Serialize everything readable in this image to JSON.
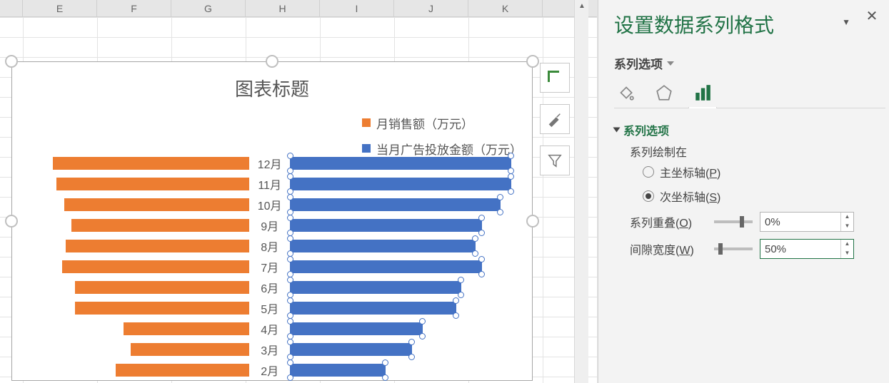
{
  "columns": [
    "E",
    "F",
    "G",
    "H",
    "I",
    "J",
    "K"
  ],
  "chart": {
    "title": "图表标题",
    "legend": {
      "series1": "月销售额（万元）",
      "series2": "当月广告投放金额（万元）"
    }
  },
  "chart_data": {
    "type": "bar",
    "orientation": "horizontal",
    "categories": [
      "12月",
      "11月",
      "10月",
      "9月",
      "8月",
      "7月",
      "6月",
      "5月",
      "4月",
      "3月",
      "2月"
    ],
    "series": [
      {
        "name": "月销售额（万元）",
        "color": "#ED7D31",
        "values": [
          265,
          260,
          250,
          240,
          248,
          252,
          235,
          235,
          170,
          160,
          180
        ]
      },
      {
        "name": "当月广告投放金额（万元）",
        "color": "#4472C4",
        "values": [
          300,
          300,
          285,
          260,
          252,
          260,
          232,
          225,
          180,
          165,
          130
        ]
      }
    ],
    "note": "Left orange bars plotted on reversed primary axis (grow leftward); right blue bars on secondary axis (selected). Values estimated from relative bar lengths; axes not shown.",
    "layout": {
      "legend_position": "top-right",
      "grid": false
    }
  },
  "tools": {
    "add": "plus-icon",
    "style": "brush-icon",
    "filter": "funnel-icon"
  },
  "pane": {
    "title": "设置数据系列格式",
    "subtitle": "系列选项",
    "section_header": "系列选项",
    "plot_on_label": "系列绘制在",
    "primary_axis": "主坐标轴",
    "primary_accel": "P",
    "secondary_axis": "次坐标轴",
    "secondary_accel": "S",
    "overlap_label": "系列重叠",
    "overlap_accel": "O",
    "overlap_value": "0%",
    "gap_label": "间隙宽度",
    "gap_accel": "W",
    "gap_value": "50%"
  }
}
